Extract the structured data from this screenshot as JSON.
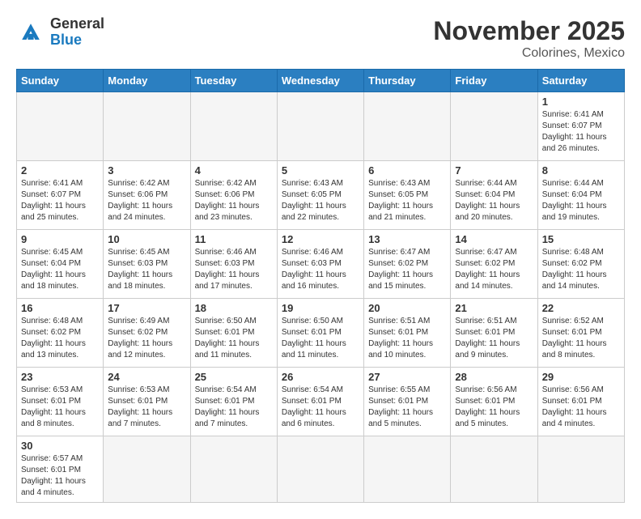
{
  "header": {
    "logo_general": "General",
    "logo_blue": "Blue",
    "month": "November 2025",
    "location": "Colorines, Mexico"
  },
  "weekdays": [
    "Sunday",
    "Monday",
    "Tuesday",
    "Wednesday",
    "Thursday",
    "Friday",
    "Saturday"
  ],
  "weeks": [
    [
      {
        "day": "",
        "info": ""
      },
      {
        "day": "",
        "info": ""
      },
      {
        "day": "",
        "info": ""
      },
      {
        "day": "",
        "info": ""
      },
      {
        "day": "",
        "info": ""
      },
      {
        "day": "",
        "info": ""
      },
      {
        "day": "1",
        "info": "Sunrise: 6:41 AM\nSunset: 6:07 PM\nDaylight: 11 hours\nand 26 minutes."
      }
    ],
    [
      {
        "day": "2",
        "info": "Sunrise: 6:41 AM\nSunset: 6:07 PM\nDaylight: 11 hours\nand 25 minutes."
      },
      {
        "day": "3",
        "info": "Sunrise: 6:42 AM\nSunset: 6:06 PM\nDaylight: 11 hours\nand 24 minutes."
      },
      {
        "day": "4",
        "info": "Sunrise: 6:42 AM\nSunset: 6:06 PM\nDaylight: 11 hours\nand 23 minutes."
      },
      {
        "day": "5",
        "info": "Sunrise: 6:43 AM\nSunset: 6:05 PM\nDaylight: 11 hours\nand 22 minutes."
      },
      {
        "day": "6",
        "info": "Sunrise: 6:43 AM\nSunset: 6:05 PM\nDaylight: 11 hours\nand 21 minutes."
      },
      {
        "day": "7",
        "info": "Sunrise: 6:44 AM\nSunset: 6:04 PM\nDaylight: 11 hours\nand 20 minutes."
      },
      {
        "day": "8",
        "info": "Sunrise: 6:44 AM\nSunset: 6:04 PM\nDaylight: 11 hours\nand 19 minutes."
      }
    ],
    [
      {
        "day": "9",
        "info": "Sunrise: 6:45 AM\nSunset: 6:04 PM\nDaylight: 11 hours\nand 18 minutes."
      },
      {
        "day": "10",
        "info": "Sunrise: 6:45 AM\nSunset: 6:03 PM\nDaylight: 11 hours\nand 18 minutes."
      },
      {
        "day": "11",
        "info": "Sunrise: 6:46 AM\nSunset: 6:03 PM\nDaylight: 11 hours\nand 17 minutes."
      },
      {
        "day": "12",
        "info": "Sunrise: 6:46 AM\nSunset: 6:03 PM\nDaylight: 11 hours\nand 16 minutes."
      },
      {
        "day": "13",
        "info": "Sunrise: 6:47 AM\nSunset: 6:02 PM\nDaylight: 11 hours\nand 15 minutes."
      },
      {
        "day": "14",
        "info": "Sunrise: 6:47 AM\nSunset: 6:02 PM\nDaylight: 11 hours\nand 14 minutes."
      },
      {
        "day": "15",
        "info": "Sunrise: 6:48 AM\nSunset: 6:02 PM\nDaylight: 11 hours\nand 14 minutes."
      }
    ],
    [
      {
        "day": "16",
        "info": "Sunrise: 6:48 AM\nSunset: 6:02 PM\nDaylight: 11 hours\nand 13 minutes."
      },
      {
        "day": "17",
        "info": "Sunrise: 6:49 AM\nSunset: 6:02 PM\nDaylight: 11 hours\nand 12 minutes."
      },
      {
        "day": "18",
        "info": "Sunrise: 6:50 AM\nSunset: 6:01 PM\nDaylight: 11 hours\nand 11 minutes."
      },
      {
        "day": "19",
        "info": "Sunrise: 6:50 AM\nSunset: 6:01 PM\nDaylight: 11 hours\nand 11 minutes."
      },
      {
        "day": "20",
        "info": "Sunrise: 6:51 AM\nSunset: 6:01 PM\nDaylight: 11 hours\nand 10 minutes."
      },
      {
        "day": "21",
        "info": "Sunrise: 6:51 AM\nSunset: 6:01 PM\nDaylight: 11 hours\nand 9 minutes."
      },
      {
        "day": "22",
        "info": "Sunrise: 6:52 AM\nSunset: 6:01 PM\nDaylight: 11 hours\nand 8 minutes."
      }
    ],
    [
      {
        "day": "23",
        "info": "Sunrise: 6:53 AM\nSunset: 6:01 PM\nDaylight: 11 hours\nand 8 minutes."
      },
      {
        "day": "24",
        "info": "Sunrise: 6:53 AM\nSunset: 6:01 PM\nDaylight: 11 hours\nand 7 minutes."
      },
      {
        "day": "25",
        "info": "Sunrise: 6:54 AM\nSunset: 6:01 PM\nDaylight: 11 hours\nand 7 minutes."
      },
      {
        "day": "26",
        "info": "Sunrise: 6:54 AM\nSunset: 6:01 PM\nDaylight: 11 hours\nand 6 minutes."
      },
      {
        "day": "27",
        "info": "Sunrise: 6:55 AM\nSunset: 6:01 PM\nDaylight: 11 hours\nand 5 minutes."
      },
      {
        "day": "28",
        "info": "Sunrise: 6:56 AM\nSunset: 6:01 PM\nDaylight: 11 hours\nand 5 minutes."
      },
      {
        "day": "29",
        "info": "Sunrise: 6:56 AM\nSunset: 6:01 PM\nDaylight: 11 hours\nand 4 minutes."
      }
    ],
    [
      {
        "day": "30",
        "info": "Sunrise: 6:57 AM\nSunset: 6:01 PM\nDaylight: 11 hours\nand 4 minutes."
      },
      {
        "day": "",
        "info": ""
      },
      {
        "day": "",
        "info": ""
      },
      {
        "day": "",
        "info": ""
      },
      {
        "day": "",
        "info": ""
      },
      {
        "day": "",
        "info": ""
      },
      {
        "day": "",
        "info": ""
      }
    ]
  ]
}
